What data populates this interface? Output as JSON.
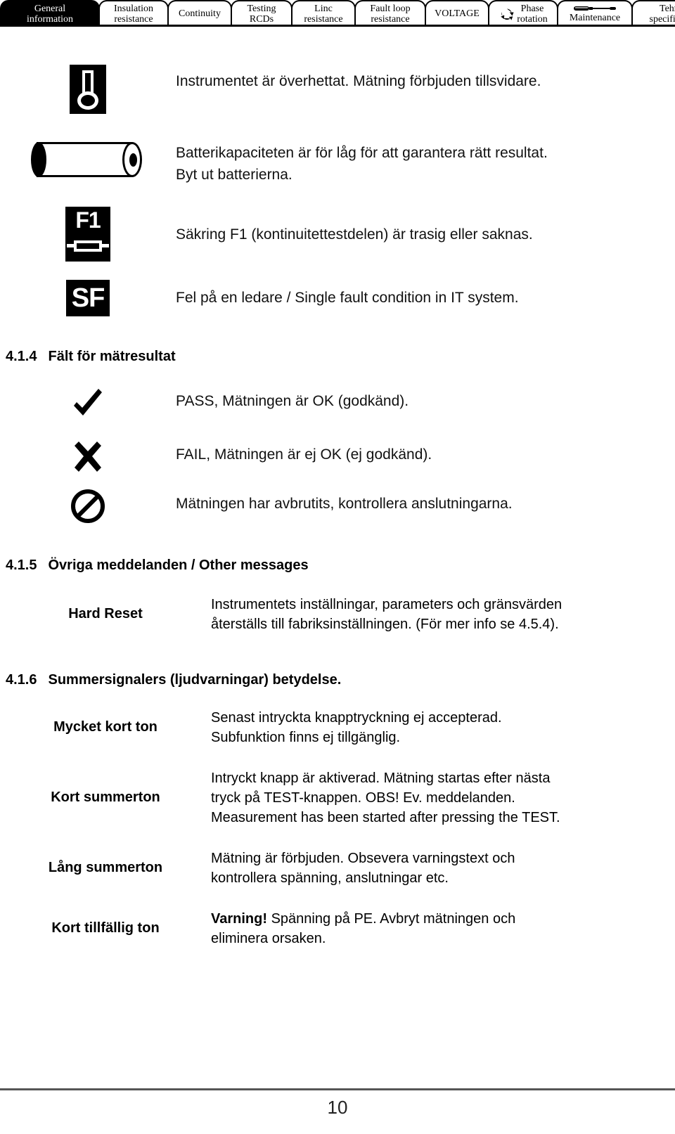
{
  "tabbar": {
    "tabs": [
      {
        "id": "general-information",
        "lines": [
          "General",
          "information"
        ],
        "active": true,
        "icon": null
      },
      {
        "id": "insulation-resistance",
        "lines": [
          "Insulation",
          "resistance"
        ],
        "active": false,
        "icon": null
      },
      {
        "id": "continuity",
        "lines": [
          "Continuity"
        ],
        "active": false,
        "icon": null
      },
      {
        "id": "testing-rcds",
        "lines": [
          "Testing",
          "RCDs"
        ],
        "active": false,
        "icon": null
      },
      {
        "id": "line-resistance",
        "lines": [
          "Linc",
          "resistance"
        ],
        "active": false,
        "icon": null
      },
      {
        "id": "fault-loop-resistance",
        "lines": [
          "Fault loop",
          "resistance"
        ],
        "active": false,
        "icon": null
      },
      {
        "id": "voltage",
        "lines": [
          "VOLTAGE"
        ],
        "active": false,
        "icon": null
      },
      {
        "id": "phase-rotation",
        "lines": [
          "Phase",
          "rotation"
        ],
        "active": false,
        "icon": "phase-rotation-icon"
      },
      {
        "id": "maintenance",
        "lines": [
          "Maintenance"
        ],
        "active": false,
        "icon": "screwdriver-icon"
      },
      {
        "id": "technical-specifications",
        "lines": [
          "Tehnical",
          "specifications"
        ],
        "active": false,
        "icon": null
      }
    ]
  },
  "warnings": [
    {
      "icon": "thermometer-icon",
      "text": "Instrumentet är överhettat. Mätning förbjuden tillsvidare."
    },
    {
      "icon": "battery-icon",
      "line1": "Batterikapaciteten är för låg för att garantera rätt resultat.",
      "line2": "Byt ut batterierna."
    },
    {
      "icon": "fuse-f1-icon",
      "text": "Säkring F1 (kontinuitettestdelen) är trasig eller saknas."
    },
    {
      "icon": "sf-icon",
      "text": "Fel på en ledare / Single fault condition in IT system."
    }
  ],
  "section_414": {
    "number": "4.1.4",
    "title": "Fält för mätresultat",
    "items": [
      {
        "icon": "check-icon",
        "text": "PASS, Mätningen är OK (godkänd)."
      },
      {
        "icon": "cross-icon",
        "text": "FAIL, Mätningen är ej OK (ej godkänd)."
      },
      {
        "icon": "prohibited-icon",
        "text": "Mätningen har avbrutits, kontrollera anslutningarna."
      }
    ]
  },
  "section_415": {
    "number": "4.1.5",
    "title": "Övriga meddelanden / Other messages",
    "rows": [
      {
        "term": "Hard Reset",
        "lines": [
          "Instrumentets inställningar, parameters och gränsvärden",
          "återställs till fabriksinställningen. (För mer info se 4.5.4)."
        ]
      }
    ]
  },
  "section_416": {
    "number": "4.1.6",
    "title": "Summersignalers (ljudvarningar) betydelse.",
    "rows": [
      {
        "term": "Mycket kort ton",
        "lines": [
          "Senast intryckta knapptryckning ej accepterad.",
          "Subfunktion finns ej tillgänglig."
        ]
      },
      {
        "term": "Kort summerton",
        "lines": [
          "Intryckt knapp är aktiverad. Mätning startas efter nästa",
          "tryck på TEST-knappen. OBS! Ev. meddelanden.",
          "Measurement has been started after pressing the TEST."
        ]
      },
      {
        "term": "Lång summerton",
        "lines": [
          "Mätning är förbjuden. Obsevera varningstext och",
          "kontrollera spänning, anslutningar etc."
        ]
      },
      {
        "term": "Kort tillfällig ton",
        "bold_lead": "Varning!",
        "lines": [
          " Spänning på PE. Avbryt mätningen och",
          "eliminera orsaken."
        ]
      }
    ]
  },
  "footer": {
    "page_number": "10"
  }
}
